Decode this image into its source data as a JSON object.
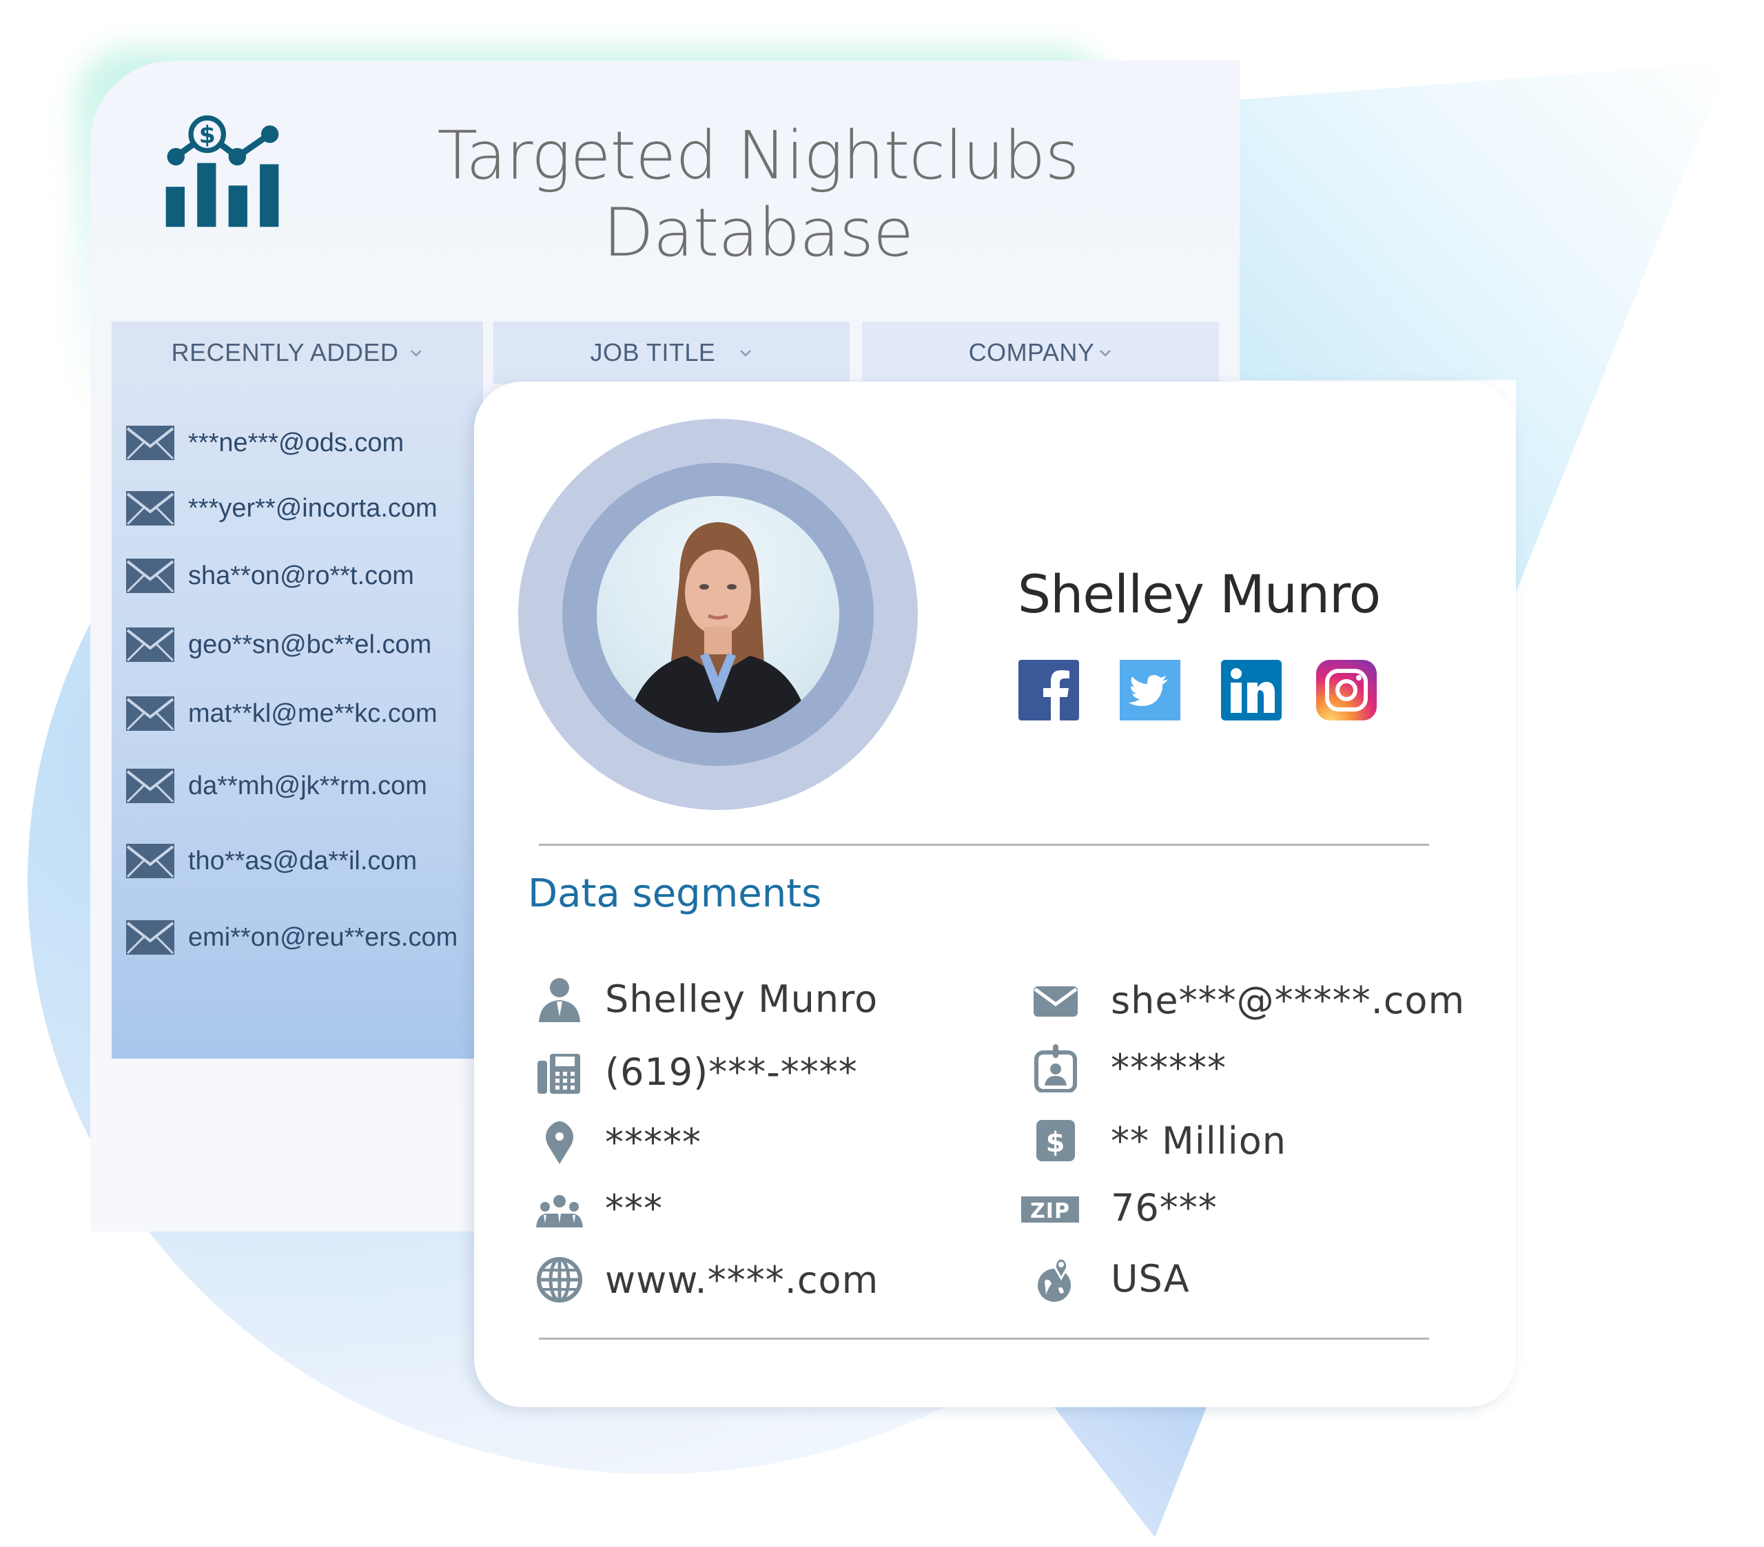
{
  "header": {
    "title_line1": "Targeted Nightclubs",
    "title_line2": "Database",
    "logo_icon": "chart-dollar-icon"
  },
  "tabs": [
    {
      "label": "RECENTLY ADDED",
      "icon": "chevron-down-icon"
    },
    {
      "label": "JOB TITLE",
      "icon": "chevron-down-icon"
    },
    {
      "label": "COMPANY",
      "icon": "chevron-down-icon"
    }
  ],
  "recent_emails": [
    {
      "icon": "envelope-icon",
      "email": "***ne***@ods.com"
    },
    {
      "icon": "envelope-icon",
      "email": "***yer**@incorta.com"
    },
    {
      "icon": "envelope-icon",
      "email": "sha**on@ro**t.com"
    },
    {
      "icon": "envelope-icon",
      "email": "geo**sn@bc**el.com"
    },
    {
      "icon": "envelope-icon",
      "email": "mat**kl@me**kc.com"
    },
    {
      "icon": "envelope-icon",
      "email": "da**mh@jk**rm.com"
    },
    {
      "icon": "envelope-icon",
      "email": "tho**as@da**il.com"
    },
    {
      "icon": "envelope-icon",
      "email": "emi**on@reu**ers.com"
    }
  ],
  "profile": {
    "name": "Shelley Munro",
    "avatar": "profile-photo",
    "social": [
      {
        "name": "facebook",
        "icon": "facebook-icon",
        "color": "#3b5998"
      },
      {
        "name": "twitter",
        "icon": "twitter-icon",
        "color": "#55acee"
      },
      {
        "name": "linkedin",
        "icon": "linkedin-icon",
        "color": "#0077b5"
      },
      {
        "name": "instagram",
        "icon": "instagram-icon",
        "color": "#d6249f"
      }
    ]
  },
  "data_segments": {
    "title": "Data segments",
    "left": [
      {
        "icon": "person-icon",
        "value": "Shelley Munro"
      },
      {
        "icon": "phone-icon",
        "value": "(619)***-****"
      },
      {
        "icon": "location-pin-icon",
        "value": "*****"
      },
      {
        "icon": "group-icon",
        "value": "***"
      },
      {
        "icon": "globe-icon",
        "value": "www.****.com"
      }
    ],
    "right": [
      {
        "icon": "envelope-icon",
        "value": "she***@*****.com"
      },
      {
        "icon": "id-badge-icon",
        "value": "******"
      },
      {
        "icon": "dollar-icon",
        "value": "** Million"
      },
      {
        "icon": "zip-icon",
        "value": "76***",
        "badge": "ZIP"
      },
      {
        "icon": "globe-pin-icon",
        "value": "USA"
      }
    ]
  },
  "colors": {
    "accent": "#1d6fa3",
    "logo": "#0f5e7c",
    "icon_gray": "#7a8d9a",
    "envelope": "#4a6483"
  }
}
